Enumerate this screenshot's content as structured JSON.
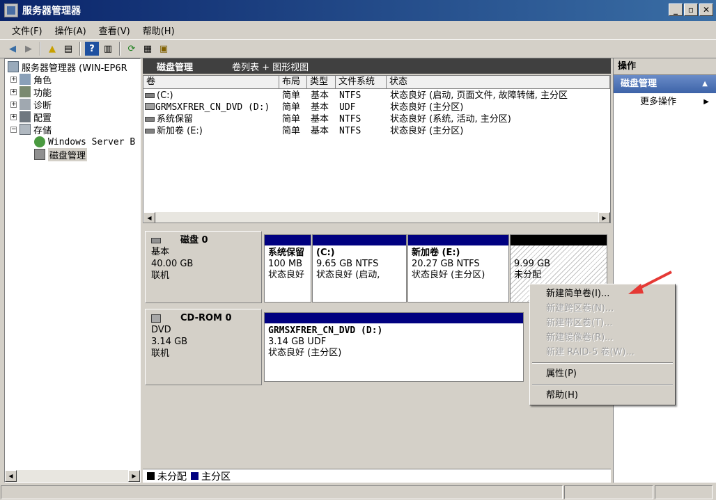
{
  "window": {
    "title": "服务器管理器"
  },
  "menu": [
    "文件(F)",
    "操作(A)",
    "查看(V)",
    "帮助(H)"
  ],
  "tree": [
    {
      "label": "服务器管理器 (WIN-EP6R",
      "level": 0,
      "expander": "",
      "icon": "server-manager-icon"
    },
    {
      "label": "角色",
      "level": 1,
      "expander": "+",
      "icon": "roles-icon"
    },
    {
      "label": "功能",
      "level": 1,
      "expander": "+",
      "icon": "features-icon"
    },
    {
      "label": "诊断",
      "level": 1,
      "expander": "+",
      "icon": "diagnostics-icon"
    },
    {
      "label": "配置",
      "level": 1,
      "expander": "+",
      "icon": "configuration-icon"
    },
    {
      "label": "存储",
      "level": 1,
      "expander": "−",
      "icon": "storage-icon"
    },
    {
      "label": "Windows Server B",
      "level": 2,
      "expander": "",
      "icon": "backup-icon"
    },
    {
      "label": "磁盘管理",
      "level": 2,
      "expander": "",
      "icon": "disk-management-icon",
      "selected": true
    }
  ],
  "center": {
    "title": "磁盘管理",
    "subtitle": "卷列表 + 图形视图",
    "columns": [
      "卷",
      "布局",
      "类型",
      "文件系统",
      "状态"
    ],
    "rows": [
      [
        "(C:)",
        "简单",
        "基本",
        "NTFS",
        "状态良好 (启动, 页面文件, 故障转储, 主分区"
      ],
      [
        "GRMSXFRER_CN_DVD (D:)",
        "简单",
        "基本",
        "UDF",
        "状态良好 (主分区)"
      ],
      [
        "系统保留",
        "简单",
        "基本",
        "NTFS",
        "状态良好 (系统, 活动, 主分区)"
      ],
      [
        "新加卷 (E:)",
        "简单",
        "基本",
        "NTFS",
        "状态良好 (主分区)"
      ]
    ]
  },
  "disks": {
    "disk0": {
      "name": "磁盘 0",
      "type": "基本",
      "size": "40.00 GB",
      "status": "联机",
      "partitions": [
        {
          "name": "系统保留",
          "line1": "100 MB",
          "line2": "状态良好"
        },
        {
          "name": "(C:)",
          "line1": "9.65 GB NTFS",
          "line2": "状态良好 (启动,"
        },
        {
          "name": "新加卷 (E:)",
          "line1": "20.27 GB NTFS",
          "line2": "状态良好 (主分区)"
        },
        {
          "name": "",
          "line1": "9.99 GB",
          "line2": "未分配"
        }
      ]
    },
    "cdrom0": {
      "name": "CD-ROM 0",
      "type": "DVD",
      "size": "3.14 GB",
      "status": "联机",
      "partition": {
        "name": "GRMSXFRER_CN_DVD (D:)",
        "line1": "3.14 GB UDF",
        "line2": "状态良好 (主分区)"
      }
    }
  },
  "legend": {
    "unallocated": "未分配",
    "primary": "主分区",
    "unallocated_color": "#000000",
    "primary_color": "#000080"
  },
  "actions": {
    "header": "操作",
    "section": "磁盘管理",
    "more": "更多操作"
  },
  "context_menu": [
    {
      "label": "新建简单卷(I)...",
      "disabled": false
    },
    {
      "label": "新建跨区卷(N)...",
      "disabled": true
    },
    {
      "label": "新建带区卷(T)...",
      "disabled": true
    },
    {
      "label": "新建镜像卷(R)...",
      "disabled": true
    },
    {
      "label": "新建 RAID-5 卷(W)...",
      "disabled": true
    },
    {
      "separator": true
    },
    {
      "label": "属性(P)",
      "disabled": false
    },
    {
      "separator": true
    },
    {
      "label": "帮助(H)",
      "disabled": false
    }
  ],
  "colors": {
    "titlebar": "#0a246a",
    "accent_arrow": "#e53935",
    "partition_bar": "#000080"
  }
}
